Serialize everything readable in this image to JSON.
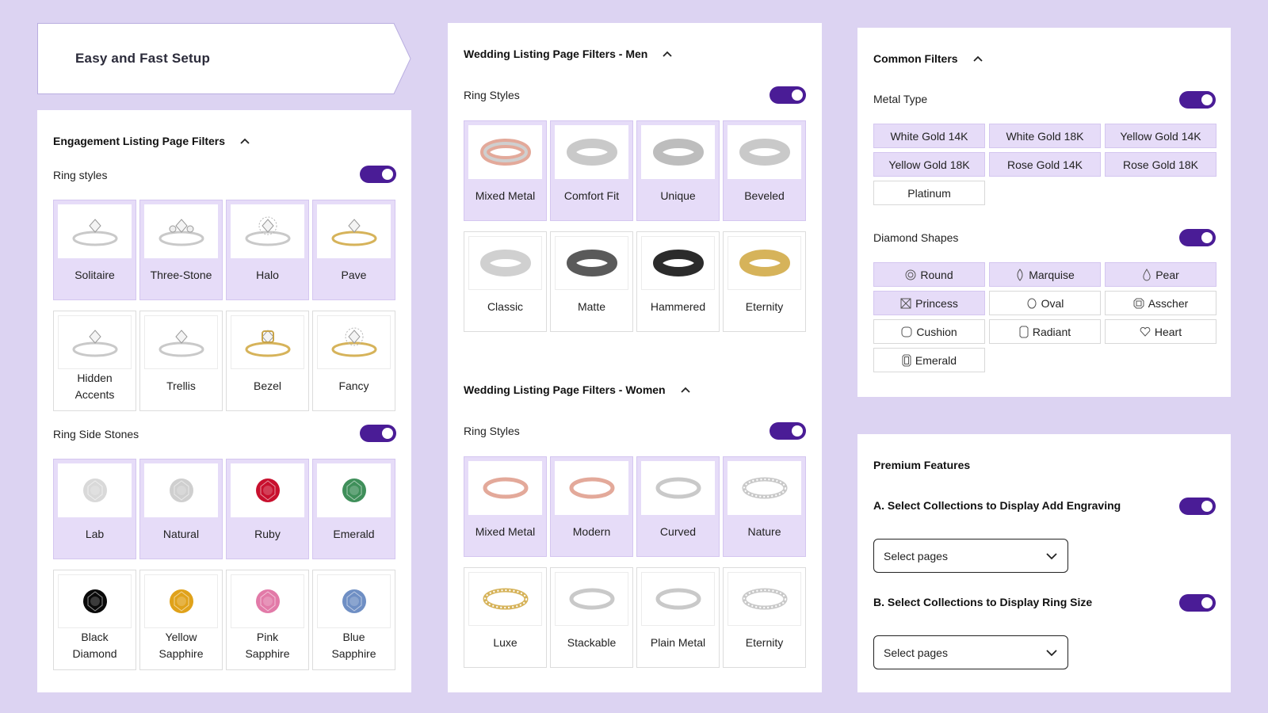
{
  "banner": {
    "title": "Easy and Fast Setup"
  },
  "engagement": {
    "title": "Engagement Listing Page Filters",
    "ring_styles": {
      "label": "Ring styles",
      "enabled": true,
      "items": [
        {
          "name": "Solitaire",
          "selected": true
        },
        {
          "name": "Three-Stone",
          "selected": true
        },
        {
          "name": "Halo",
          "selected": true
        },
        {
          "name": "Pave",
          "selected": true
        },
        {
          "name": "Hidden\nAccents",
          "selected": false
        },
        {
          "name": "Trellis",
          "selected": false
        },
        {
          "name": "Bezel",
          "selected": false
        },
        {
          "name": "Fancy",
          "selected": false
        }
      ]
    },
    "side_stones": {
      "label": "Ring Side Stones",
      "enabled": true,
      "items": [
        {
          "name": "Lab",
          "selected": true,
          "color": "#d9d9d9"
        },
        {
          "name": "Natural",
          "selected": true,
          "color": "#cfcfcf"
        },
        {
          "name": "Ruby",
          "selected": true,
          "color": "#c8102e"
        },
        {
          "name": "Emerald",
          "selected": true,
          "color": "#3f8f5a"
        },
        {
          "name": "Black\nDiamond",
          "selected": false,
          "color": "#0a0a0a"
        },
        {
          "name": "Yellow\nSapphire",
          "selected": false,
          "color": "#e0a21a"
        },
        {
          "name": "Pink\nSapphire",
          "selected": false,
          "color": "#e27aa8"
        },
        {
          "name": "Blue\nSapphire",
          "selected": false,
          "color": "#6f8fc4"
        }
      ]
    }
  },
  "wedding_men": {
    "title": "Wedding Listing Page Filters - Men",
    "label": "Ring Styles",
    "enabled": true,
    "items": [
      {
        "name": "Mixed Metal",
        "selected": true
      },
      {
        "name": "Comfort Fit",
        "selected": true
      },
      {
        "name": "Unique",
        "selected": true
      },
      {
        "name": "Beveled",
        "selected": true
      },
      {
        "name": "Classic",
        "selected": false
      },
      {
        "name": "Matte",
        "selected": false
      },
      {
        "name": "Hammered",
        "selected": false
      },
      {
        "name": "Eternity",
        "selected": false
      }
    ]
  },
  "wedding_women": {
    "title": "Wedding Listing Page Filters - Women",
    "label": "Ring Styles",
    "enabled": true,
    "items": [
      {
        "name": "Mixed Metal",
        "selected": true
      },
      {
        "name": "Modern",
        "selected": true
      },
      {
        "name": "Curved",
        "selected": true
      },
      {
        "name": "Nature",
        "selected": true
      },
      {
        "name": "Luxe",
        "selected": false
      },
      {
        "name": "Stackable",
        "selected": false
      },
      {
        "name": "Plain Metal",
        "selected": false
      },
      {
        "name": "Eternity",
        "selected": false
      }
    ]
  },
  "common": {
    "title": "Common Filters",
    "metal": {
      "label": "Metal Type",
      "enabled": true,
      "items": [
        {
          "name": "White Gold 14K",
          "selected": true
        },
        {
          "name": "White Gold 18K",
          "selected": true
        },
        {
          "name": "Yellow Gold 14K",
          "selected": true
        },
        {
          "name": "Yellow Gold 18K",
          "selected": true
        },
        {
          "name": "Rose Gold 14K",
          "selected": true
        },
        {
          "name": "Rose Gold 18K",
          "selected": true
        },
        {
          "name": "Platinum",
          "selected": false
        }
      ]
    },
    "shapes": {
      "label": "Diamond Shapes",
      "enabled": true,
      "items": [
        {
          "name": "Round",
          "selected": true,
          "icon": "round-diamond-icon"
        },
        {
          "name": "Marquise",
          "selected": true,
          "icon": "marquise-diamond-icon"
        },
        {
          "name": "Pear",
          "selected": true,
          "icon": "pear-diamond-icon"
        },
        {
          "name": "Princess",
          "selected": true,
          "icon": "princess-diamond-icon"
        },
        {
          "name": "Oval",
          "selected": false,
          "icon": "oval-diamond-icon"
        },
        {
          "name": "Asscher",
          "selected": false,
          "icon": "asscher-diamond-icon"
        },
        {
          "name": "Cushion",
          "selected": false,
          "icon": "cushion-diamond-icon"
        },
        {
          "name": "Radiant",
          "selected": false,
          "icon": "radiant-diamond-icon"
        },
        {
          "name": "Heart",
          "selected": false,
          "icon": "heart-diamond-icon"
        },
        {
          "name": "Emerald",
          "selected": false,
          "icon": "emerald-diamond-icon"
        }
      ]
    }
  },
  "premium": {
    "title": "Premium Features",
    "engraving": {
      "label": "A. Select Collections to Display Add Engraving",
      "enabled": true,
      "select": "Select pages"
    },
    "ring_size": {
      "label": "B. Select Collections to Display Ring Size",
      "enabled": true,
      "select": "Select pages"
    }
  },
  "colors": {
    "accent": "#4a1c96",
    "selected_tile": "#e6dcf8",
    "background": "#dcd3f2"
  }
}
